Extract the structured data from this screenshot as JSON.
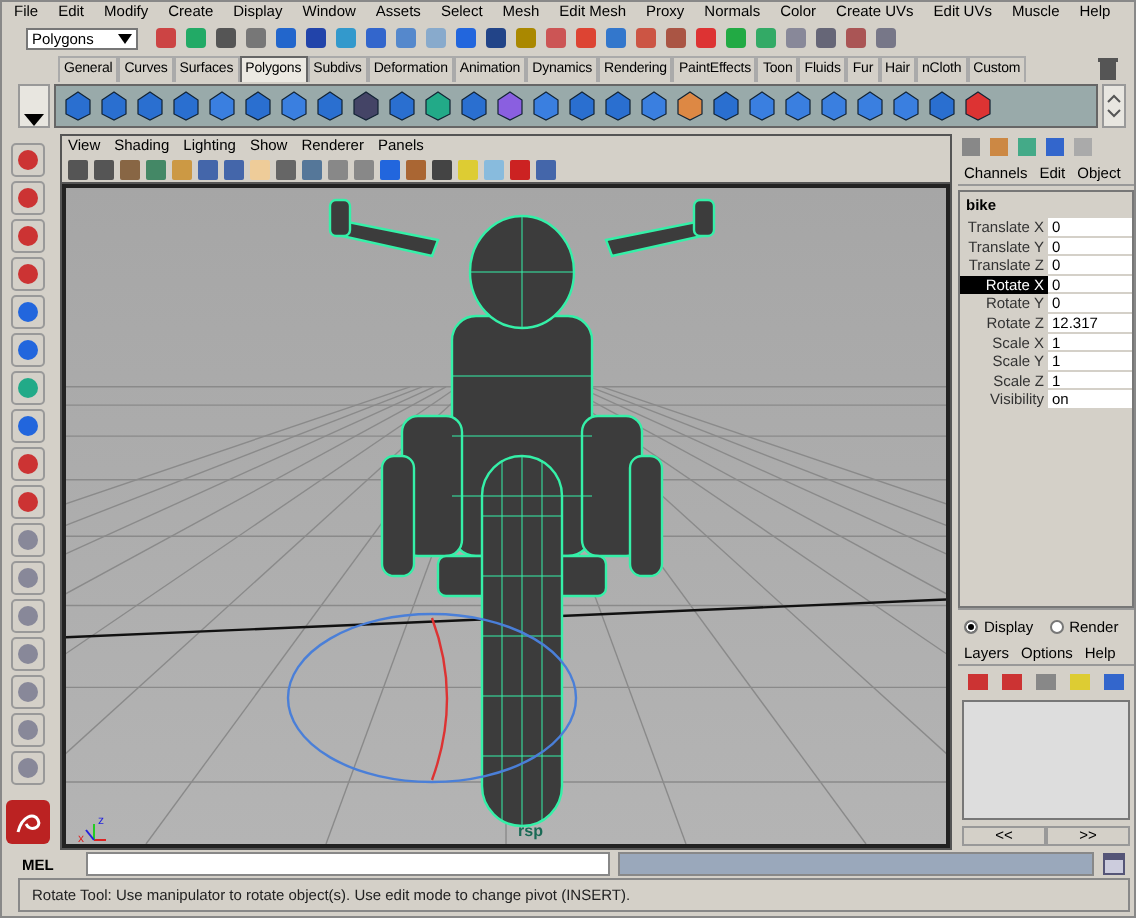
{
  "menu_bar": [
    "File",
    "Edit",
    "Modify",
    "Create",
    "Display",
    "Window",
    "Assets",
    "Select",
    "Mesh",
    "Edit Mesh",
    "Proxy",
    "Normals",
    "Color",
    "Create UVs",
    "Edit UVs",
    "Muscle",
    "Help"
  ],
  "status_line": {
    "menu_set": "Polygons"
  },
  "shelf_tabs": [
    {
      "label": "General",
      "selected": false
    },
    {
      "label": "Curves",
      "selected": false
    },
    {
      "label": "Surfaces",
      "selected": false
    },
    {
      "label": "Polygons",
      "selected": true
    },
    {
      "label": "Subdivs",
      "selected": false
    },
    {
      "label": "Deformation",
      "selected": false
    },
    {
      "label": "Animation",
      "selected": false
    },
    {
      "label": "Dynamics",
      "selected": false
    },
    {
      "label": "Rendering",
      "selected": false
    },
    {
      "label": "PaintEffects",
      "selected": false
    },
    {
      "label": "Toon",
      "selected": false
    },
    {
      "label": "Fluids",
      "selected": false
    },
    {
      "label": "Fur",
      "selected": false
    },
    {
      "label": "Hair",
      "selected": false
    },
    {
      "label": "nCloth",
      "selected": false
    },
    {
      "label": "Custom",
      "selected": false
    }
  ],
  "viewport": {
    "menus": [
      "View",
      "Shading",
      "Lighting",
      "Show",
      "Renderer",
      "Panels"
    ],
    "camera_label": "rsp",
    "axis_labels": [
      "x",
      "z"
    ]
  },
  "channel_box": {
    "menus": [
      "Channels",
      "Edit",
      "Object"
    ],
    "object": "bike",
    "attributes": [
      {
        "name": "Translate X",
        "value": "0",
        "selected": false
      },
      {
        "name": "Translate Y",
        "value": "0",
        "selected": false
      },
      {
        "name": "Translate Z",
        "value": "0",
        "selected": false
      },
      {
        "name": "Rotate X",
        "value": "0",
        "selected": true
      },
      {
        "name": "Rotate Y",
        "value": "0",
        "selected": false
      },
      {
        "name": "Rotate Z",
        "value": "12.317",
        "selected": false
      },
      {
        "name": "Scale X",
        "value": "1",
        "selected": false
      },
      {
        "name": "Scale Y",
        "value": "1",
        "selected": false
      },
      {
        "name": "Scale Z",
        "value": "1",
        "selected": false
      },
      {
        "name": "Visibility",
        "value": "on",
        "selected": false
      }
    ]
  },
  "layer_editor": {
    "modes": [
      {
        "label": "Display",
        "selected": true
      },
      {
        "label": "Render",
        "selected": false
      }
    ],
    "menus": [
      "Layers",
      "Options",
      "Help"
    ],
    "nav": [
      "<<",
      ">>"
    ]
  },
  "command_line": {
    "label": "MEL"
  },
  "help_line": "Rotate Tool: Use manipulator to rotate object(s). Use edit mode to change pivot (INSERT)."
}
